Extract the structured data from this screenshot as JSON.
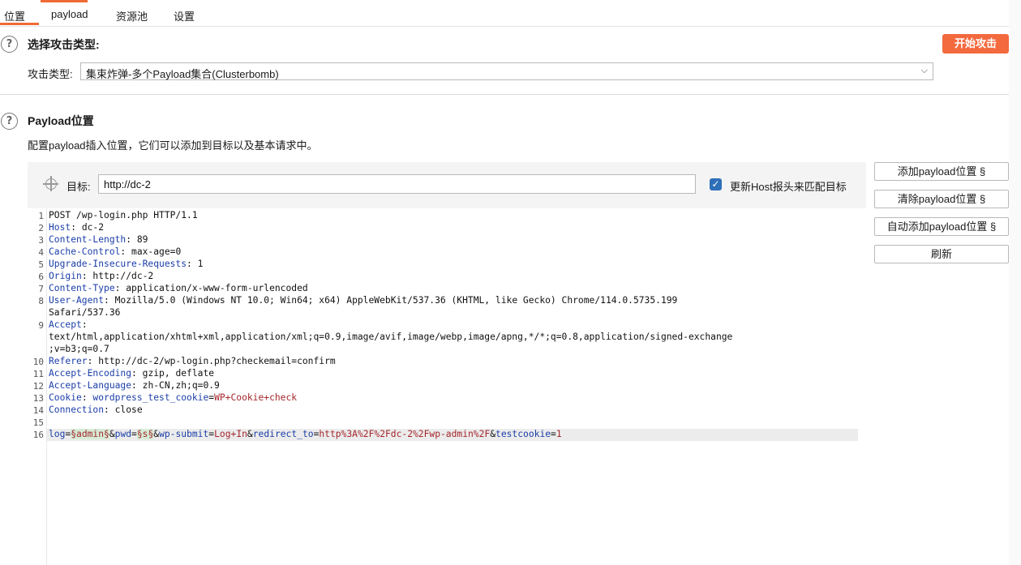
{
  "tabs": [
    {
      "label": "位置"
    },
    {
      "label": "payload"
    },
    {
      "label": "资源池"
    },
    {
      "label": "设置"
    }
  ],
  "attack": {
    "section_title": "选择攻击类型:",
    "start_button": "开始攻击",
    "type_label": "攻击类型:",
    "type_value": "集束炸弹-多个Payload集合(Clusterbomb)"
  },
  "positions": {
    "section_title": "Payload位置",
    "description": "配置payload插入位置，它们可以添加到目标以及基本请求中。",
    "target_label": "目标:",
    "target_value": "http://dc-2",
    "update_host_label": "更新Host报头来匹配目标",
    "update_host_checked": true
  },
  "side_buttons": {
    "add": "添加payload位置 §",
    "clear": "清除payload位置 §",
    "auto": "自动添加payload位置 §",
    "refresh": "刷新"
  },
  "request": {
    "line_numbers": [
      "1",
      "2",
      "3",
      "4",
      "5",
      "6",
      "7",
      "8",
      "9",
      "10",
      "11",
      "12",
      "13",
      "14",
      "15",
      "16"
    ],
    "request_line": "POST /wp-login.php HTTP/1.1",
    "headers": [
      {
        "name": "Host",
        "value": "dc-2"
      },
      {
        "name": "Content-Length",
        "value": "89"
      },
      {
        "name": "Cache-Control",
        "value": "max-age=0"
      },
      {
        "name": "Upgrade-Insecure-Requests",
        "value": "1"
      },
      {
        "name": "Origin",
        "value": "http://dc-2"
      },
      {
        "name": "Content-Type",
        "value": "application/x-www-form-urlencoded"
      },
      {
        "name": "User-Agent",
        "value": "Mozilla/5.0 (Windows NT 10.0; Win64; x64) AppleWebKit/537.36 (KHTML, like Gecko) Chrome/114.0.5735.199"
      },
      {
        "name": "Accept",
        "value": ""
      },
      {
        "name": "Referer",
        "value": "http://dc-2/wp-login.php?checkemail=confirm"
      },
      {
        "name": "Accept-Encoding",
        "value": "gzip, deflate"
      },
      {
        "name": "Accept-Language",
        "value": "zh-CN,zh;q=0.9"
      },
      {
        "name": "Cookie",
        "value": "WP+Cookie+check"
      },
      {
        "name": "Connection",
        "value": "close"
      }
    ],
    "ua_wrap": "Safari/537.36",
    "accept_wrap_1": "text/html,application/xhtml+xml,application/xml;q=0.9,image/avif,image/webp,image/apng,*/*;q=0.8,application/signed-exchange",
    "accept_wrap_2": ";v=b3;q=0.7",
    "cookie_name": "wordpress_test_cookie",
    "body": {
      "p1_name": "log",
      "p1_value": "§admin§",
      "p2_name": "pwd",
      "p2_value": "§s§",
      "p3_name": "wp-submit",
      "p3_value": "Log+In",
      "p4_name": "redirect_to",
      "p4_value": "http%3A%2F%2Fdc-2%2Fwp-admin%2F",
      "p5_name": "testcookie",
      "p5_value": "1"
    }
  },
  "colors": {
    "accent": "#f06a35",
    "header_name": "#1b3ea8",
    "param_value": "#a4262c",
    "checkbox": "#2f6fb8"
  }
}
